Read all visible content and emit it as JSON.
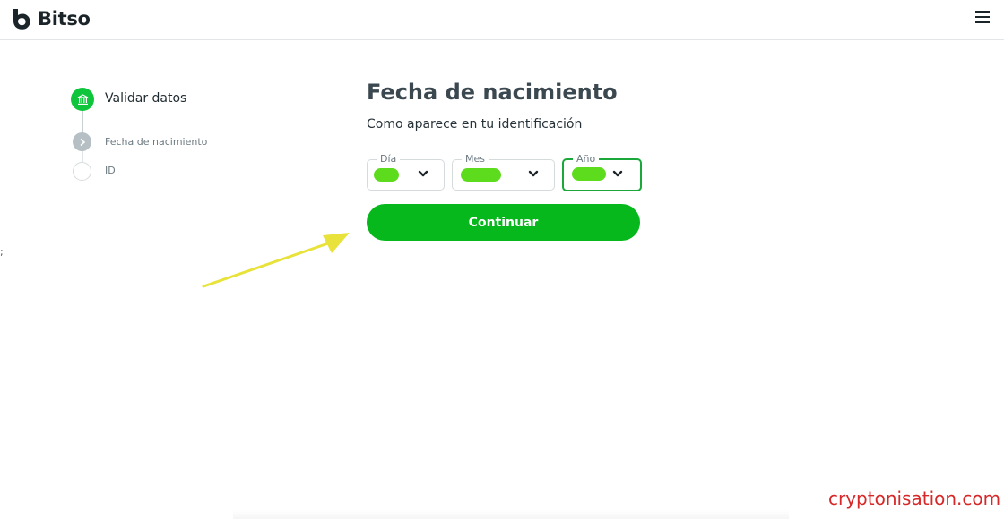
{
  "header": {
    "brand": "Bitso",
    "logo_icon": "bitso-logo-icon",
    "menu_icon": "hamburger-menu-icon"
  },
  "stepper": {
    "steps": [
      {
        "label": "Validar datos",
        "icon": "bank-icon",
        "state": "active"
      },
      {
        "label": "Fecha de nacimiento",
        "icon": "chevron-right-icon",
        "state": "current"
      },
      {
        "label": "ID",
        "icon": "",
        "state": "pending"
      }
    ]
  },
  "form": {
    "title": "Fecha de nacimiento",
    "subtitle": "Como aparece en tu identificación",
    "fields": [
      {
        "label": "Día",
        "value": ""
      },
      {
        "label": "Mes",
        "value": ""
      },
      {
        "label": "Año",
        "value": ""
      }
    ],
    "submit_label": "Continuar"
  },
  "stray_char": ";",
  "watermark": "cryptonisation.com",
  "colors": {
    "brand_green": "#06b81c",
    "step_green": "#0fc53b",
    "highlight_green": "#5cdc1c",
    "arrow_yellow": "#e8e23a",
    "watermark_red": "#d62828"
  }
}
